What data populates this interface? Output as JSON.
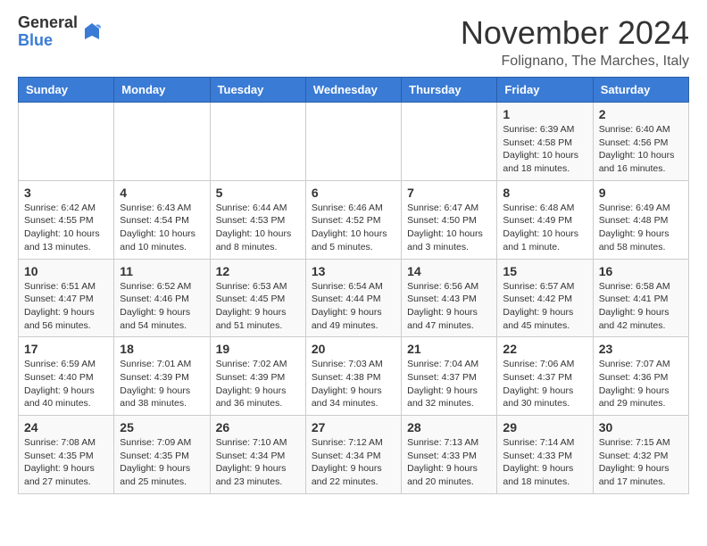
{
  "logo": {
    "general": "General",
    "blue": "Blue"
  },
  "title": "November 2024",
  "location": "Folignano, The Marches, Italy",
  "days_of_week": [
    "Sunday",
    "Monday",
    "Tuesday",
    "Wednesday",
    "Thursday",
    "Friday",
    "Saturday"
  ],
  "weeks": [
    [
      {
        "day": "",
        "info": ""
      },
      {
        "day": "",
        "info": ""
      },
      {
        "day": "",
        "info": ""
      },
      {
        "day": "",
        "info": ""
      },
      {
        "day": "",
        "info": ""
      },
      {
        "day": "1",
        "info": "Sunrise: 6:39 AM\nSunset: 4:58 PM\nDaylight: 10 hours and 18 minutes."
      },
      {
        "day": "2",
        "info": "Sunrise: 6:40 AM\nSunset: 4:56 PM\nDaylight: 10 hours and 16 minutes."
      }
    ],
    [
      {
        "day": "3",
        "info": "Sunrise: 6:42 AM\nSunset: 4:55 PM\nDaylight: 10 hours and 13 minutes."
      },
      {
        "day": "4",
        "info": "Sunrise: 6:43 AM\nSunset: 4:54 PM\nDaylight: 10 hours and 10 minutes."
      },
      {
        "day": "5",
        "info": "Sunrise: 6:44 AM\nSunset: 4:53 PM\nDaylight: 10 hours and 8 minutes."
      },
      {
        "day": "6",
        "info": "Sunrise: 6:46 AM\nSunset: 4:52 PM\nDaylight: 10 hours and 5 minutes."
      },
      {
        "day": "7",
        "info": "Sunrise: 6:47 AM\nSunset: 4:50 PM\nDaylight: 10 hours and 3 minutes."
      },
      {
        "day": "8",
        "info": "Sunrise: 6:48 AM\nSunset: 4:49 PM\nDaylight: 10 hours and 1 minute."
      },
      {
        "day": "9",
        "info": "Sunrise: 6:49 AM\nSunset: 4:48 PM\nDaylight: 9 hours and 58 minutes."
      }
    ],
    [
      {
        "day": "10",
        "info": "Sunrise: 6:51 AM\nSunset: 4:47 PM\nDaylight: 9 hours and 56 minutes."
      },
      {
        "day": "11",
        "info": "Sunrise: 6:52 AM\nSunset: 4:46 PM\nDaylight: 9 hours and 54 minutes."
      },
      {
        "day": "12",
        "info": "Sunrise: 6:53 AM\nSunset: 4:45 PM\nDaylight: 9 hours and 51 minutes."
      },
      {
        "day": "13",
        "info": "Sunrise: 6:54 AM\nSunset: 4:44 PM\nDaylight: 9 hours and 49 minutes."
      },
      {
        "day": "14",
        "info": "Sunrise: 6:56 AM\nSunset: 4:43 PM\nDaylight: 9 hours and 47 minutes."
      },
      {
        "day": "15",
        "info": "Sunrise: 6:57 AM\nSunset: 4:42 PM\nDaylight: 9 hours and 45 minutes."
      },
      {
        "day": "16",
        "info": "Sunrise: 6:58 AM\nSunset: 4:41 PM\nDaylight: 9 hours and 42 minutes."
      }
    ],
    [
      {
        "day": "17",
        "info": "Sunrise: 6:59 AM\nSunset: 4:40 PM\nDaylight: 9 hours and 40 minutes."
      },
      {
        "day": "18",
        "info": "Sunrise: 7:01 AM\nSunset: 4:39 PM\nDaylight: 9 hours and 38 minutes."
      },
      {
        "day": "19",
        "info": "Sunrise: 7:02 AM\nSunset: 4:39 PM\nDaylight: 9 hours and 36 minutes."
      },
      {
        "day": "20",
        "info": "Sunrise: 7:03 AM\nSunset: 4:38 PM\nDaylight: 9 hours and 34 minutes."
      },
      {
        "day": "21",
        "info": "Sunrise: 7:04 AM\nSunset: 4:37 PM\nDaylight: 9 hours and 32 minutes."
      },
      {
        "day": "22",
        "info": "Sunrise: 7:06 AM\nSunset: 4:37 PM\nDaylight: 9 hours and 30 minutes."
      },
      {
        "day": "23",
        "info": "Sunrise: 7:07 AM\nSunset: 4:36 PM\nDaylight: 9 hours and 29 minutes."
      }
    ],
    [
      {
        "day": "24",
        "info": "Sunrise: 7:08 AM\nSunset: 4:35 PM\nDaylight: 9 hours and 27 minutes."
      },
      {
        "day": "25",
        "info": "Sunrise: 7:09 AM\nSunset: 4:35 PM\nDaylight: 9 hours and 25 minutes."
      },
      {
        "day": "26",
        "info": "Sunrise: 7:10 AM\nSunset: 4:34 PM\nDaylight: 9 hours and 23 minutes."
      },
      {
        "day": "27",
        "info": "Sunrise: 7:12 AM\nSunset: 4:34 PM\nDaylight: 9 hours and 22 minutes."
      },
      {
        "day": "28",
        "info": "Sunrise: 7:13 AM\nSunset: 4:33 PM\nDaylight: 9 hours and 20 minutes."
      },
      {
        "day": "29",
        "info": "Sunrise: 7:14 AM\nSunset: 4:33 PM\nDaylight: 9 hours and 18 minutes."
      },
      {
        "day": "30",
        "info": "Sunrise: 7:15 AM\nSunset: 4:32 PM\nDaylight: 9 hours and 17 minutes."
      }
    ]
  ]
}
